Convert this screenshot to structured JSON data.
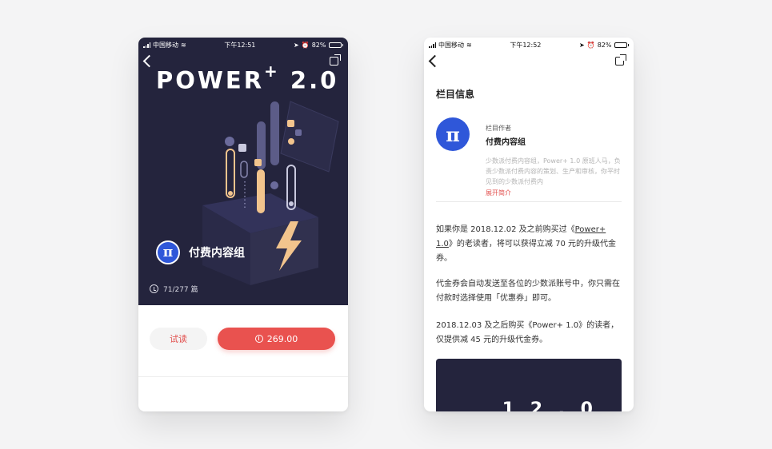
{
  "left": {
    "status": {
      "carrier": "中国移动",
      "time": "下午12:51",
      "battery": "82%"
    },
    "hero": {
      "title": "POWER",
      "title_plus": "+",
      "title_version": " 2.0",
      "author_name": "付费内容组",
      "count": "71/277 篇"
    },
    "actions": {
      "trial_label": "试读",
      "price_label": "269.00"
    }
  },
  "right": {
    "status": {
      "carrier": "中国移动",
      "time": "下午12:52",
      "battery": "82%"
    },
    "section_title": "栏目信息",
    "info": {
      "label": "栏目作者",
      "author": "付费内容组",
      "desc": "少数派付费内容组，Power+ 1.0 原班人马，负责少数派付费内容的策划、生产和审核，你平时见到的少数派付费内",
      "expand": "展开简介"
    },
    "paragraphs": [
      {
        "pre": "如果你是 2018.12.02 及之前购买过《",
        "link": "Power+ 1.0",
        "post": "》的老读者，将可以获得立减 70 元的升级代金券。"
      },
      {
        "text": "代金券会自动发送至各位的少数派账号中，你只需在付款时选择使用「优惠券」即可。"
      },
      {
        "text": "2018.12.03 及之后购买《Power+ 1.0》的读者，仅提供减 45 元的升级代金券。"
      }
    ]
  },
  "colors": {
    "hero_bg": "#24243d",
    "accent_red": "#e9524f",
    "pi_blue": "#2f57d9"
  }
}
